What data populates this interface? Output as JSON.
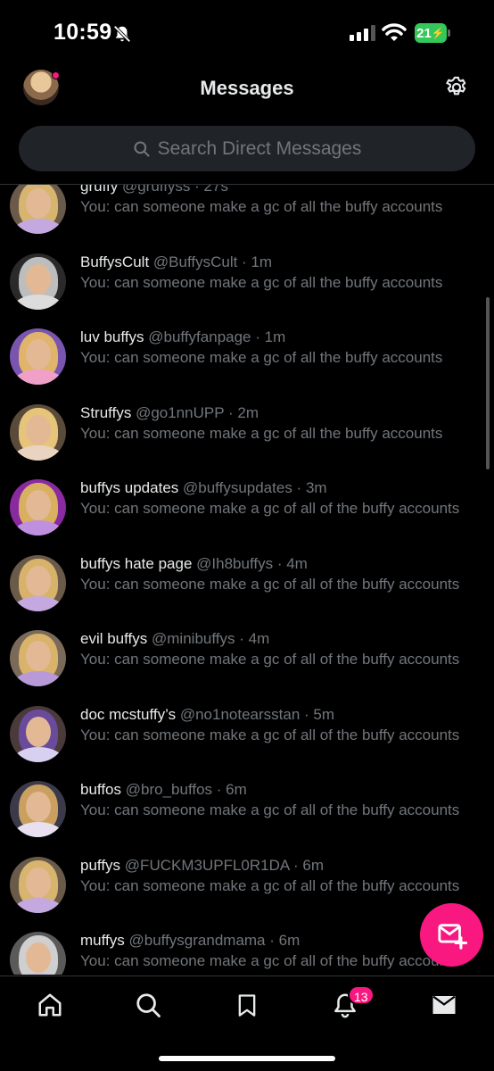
{
  "status_bar": {
    "time": "10:59",
    "battery": "21"
  },
  "header": {
    "title": "Messages"
  },
  "search": {
    "placeholder": "Search Direct Messages"
  },
  "conversations": [
    {
      "name": "gruffy",
      "handle": "@gruffyss",
      "time": "27s",
      "preview": "You: can someone make a gc of all the buffy accounts",
      "hair": "#d7b56e",
      "body": "#c4a8e0",
      "bg": "#6a5a4a"
    },
    {
      "name": "BuffysCult",
      "handle": "@BuffysCult",
      "time": "1m",
      "preview": "You: can someone make a gc of all the buffy accounts",
      "hair": "#bdbdbd",
      "body": "#dcdcdc",
      "bg": "#2a2a2a"
    },
    {
      "name": "luv buffys",
      "handle": "@buffyfanpage",
      "time": "1m",
      "preview": "You: can someone make a gc of all the buffy accounts",
      "hair": "#e0b46a",
      "body": "#f0a0c8",
      "bg": "#7a55b0"
    },
    {
      "name": "Struffys",
      "handle": "@go1nnUPP",
      "time": "2m",
      "preview": "You: can someone make a gc of all the buffy accounts",
      "hair": "#e6c57a",
      "body": "#e8d4c0",
      "bg": "#5a4a3a"
    },
    {
      "name": "buffys updates",
      "handle": "@buffysupdates",
      "time": "3m",
      "preview": "You: can someone make a gc of all of the buffy accounts",
      "hair": "#d9b060",
      "body": "#c090e0",
      "bg": "#8a2aa0"
    },
    {
      "name": "buffys hate page",
      "handle": "@Ih8buffys",
      "time": "4m",
      "preview": "You: can someone make a gc of all of the buffy accounts",
      "hair": "#d8b26a",
      "body": "#c4a8e0",
      "bg": "#6a5a4a"
    },
    {
      "name": "evil buffys",
      "handle": "@minibuffys",
      "time": "4m",
      "preview": "You: can someone make a gc of all of the buffy accounts",
      "hair": "#d9b36a",
      "body": "#b89ad8",
      "bg": "#7a6a5a"
    },
    {
      "name": "doc mcstuffy’s",
      "handle": "@no1notearsstan",
      "time": "5m",
      "preview": "You: can someone make a gc of all of the buffy accounts",
      "hair": "#6a4a9a",
      "body": "#d8d0f0",
      "bg": "#4a3a3a"
    },
    {
      "name": "buffos",
      "handle": "@bro_buffos",
      "time": "6m",
      "preview": "You: can someone make a gc of all of the buffy accounts",
      "hair": "#c9a060",
      "body": "#e8e0f0",
      "bg": "#3a3a4a"
    },
    {
      "name": "puffys",
      "handle": "@FUCKM3UPFL0R1DA",
      "time": "6m",
      "preview": "You: can someone make a gc of all of the buffy accounts",
      "hair": "#d7b56e",
      "body": "#c4a8e0",
      "bg": "#6a5a4a"
    },
    {
      "name": "muffys",
      "handle": "@buffysgrandmama",
      "time": "6m",
      "preview": "You: can someone make a gc of all of the buffy accounts",
      "hair": "#cfcfcf",
      "body": "#d0c0e0",
      "bg": "#5a5a5a"
    }
  ],
  "nav": {
    "notifications_badge": "13",
    "items": [
      "home-icon",
      "search-icon",
      "bookmark-icon",
      "notifications-icon",
      "messages-icon"
    ]
  },
  "colors": {
    "accent": "#f91880",
    "muted": "#71767b",
    "background": "#000000"
  }
}
